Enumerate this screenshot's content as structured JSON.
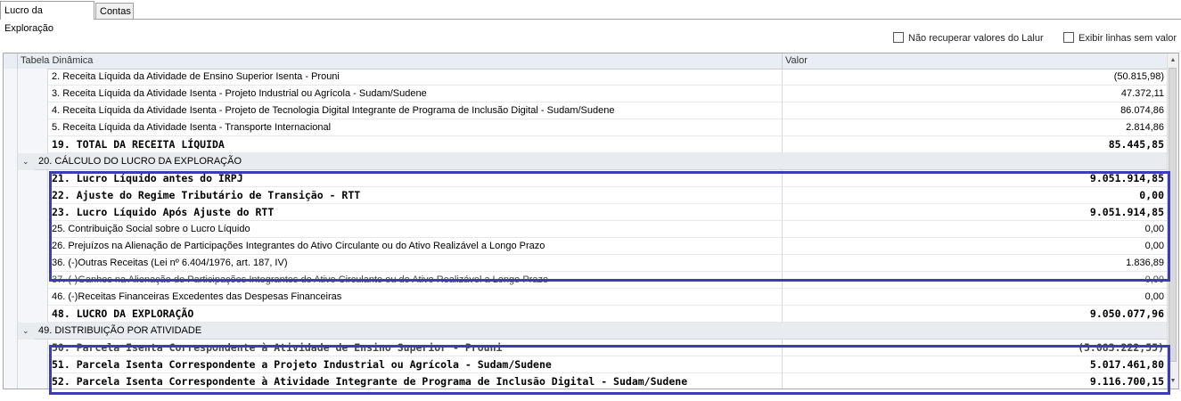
{
  "tabs": [
    {
      "label": "Lucro da Exploração",
      "active": true
    },
    {
      "label": "Contas",
      "active": false
    }
  ],
  "options": [
    {
      "label": "Não recuperar valores do Lalur",
      "checked": false
    },
    {
      "label": "Exibir linhas sem valor",
      "checked": false
    }
  ],
  "grid": {
    "columns": [
      "Tabela Dinâmica",
      "Valor"
    ],
    "rows": [
      {
        "label": "2. Receita Líquida da Atividade de Ensino Superior Isenta - Prouni",
        "value": "(50.815,98)",
        "type": "item"
      },
      {
        "label": "3. Receita Líquida da Atividade Isenta - Projeto Industrial ou Agrícola - Sudam/Sudene",
        "value": "47.372,11",
        "type": "item"
      },
      {
        "label": "4. Receita Líquida da Atividade Isenta - Projeto de Tecnologia Digital Integrante de Programa de Inclusão Digital - Sudam/Sudene",
        "value": "86.074,86",
        "type": "item"
      },
      {
        "label": "5. Receita Líquida da Atividade Isenta - Transporte Internacional",
        "value": "2.814,86",
        "type": "item"
      },
      {
        "label": "19. TOTAL DA RECEITA LÍQUIDA",
        "value": "85.445,85",
        "type": "bold"
      },
      {
        "label": "20. CÁLCULO DO LUCRO DA EXPLORAÇÃO",
        "value": "",
        "type": "group"
      },
      {
        "label": "21. Lucro Líquido antes do IRPJ",
        "value": "9.051.914,85",
        "type": "bold"
      },
      {
        "label": "22. Ajuste do Regime Tributário de Transição - RTT",
        "value": "0,00",
        "type": "bold"
      },
      {
        "label": "23. Lucro Líquido Após Ajuste do RTT",
        "value": "9.051.914,85",
        "type": "bold"
      },
      {
        "label": "25. Contribuição Social sobre o Lucro Líquido",
        "value": "0,00",
        "type": "item"
      },
      {
        "label": "26. Prejuízos na Alienação de Participações Integrantes do Ativo Circulante ou do Ativo Realizável a Longo Prazo",
        "value": "0,00",
        "type": "item"
      },
      {
        "label": "36. (-)Outras Receitas (Lei nº 6.404/1976, art. 187, IV)",
        "value": "1.836,89",
        "type": "item"
      },
      {
        "label": "37. (-)Ganhos na Alienação de Participações Integrantes do Ativo Circulante ou do Ativo Realizável a Longo Prazo",
        "value": "0,00",
        "type": "obscured"
      },
      {
        "label": "46. (-)Receitas Financeiras Excedentes das Despesas Financeiras",
        "value": "0,00",
        "type": "item"
      },
      {
        "label": "48. LUCRO DA EXPLORAÇÃO",
        "value": "9.050.077,96",
        "type": "bold"
      },
      {
        "label": "49. DISTRIBUIÇÃO POR ATIVIDADE",
        "value": "",
        "type": "group"
      },
      {
        "label": "50. Parcela Isenta Correspondente à Atividade de Ensino Superior - Prouni",
        "value": "(5.083.222,55)",
        "type": "bold obscured"
      },
      {
        "label": "51. Parcela Isenta Correspondente a Projeto Industrial ou Agrícola - Sudam/Sudene",
        "value": "5.017.461,80",
        "type": "bold"
      },
      {
        "label": "52. Parcela Isenta Correspondente à Atividade Integrante de Programa de Inclusão Digital - Sudam/Sudene",
        "value": "9.116.700,15",
        "type": "bold"
      }
    ]
  },
  "icons": {
    "expand": "chevron-down-icon",
    "scroll_up": "arrow-up-icon",
    "scroll_down": "arrow-down-icon"
  },
  "colors": {
    "highlight": "#3c3cb4",
    "header_bg": "#e9eef4",
    "group_bg": "#e8ecf1"
  }
}
